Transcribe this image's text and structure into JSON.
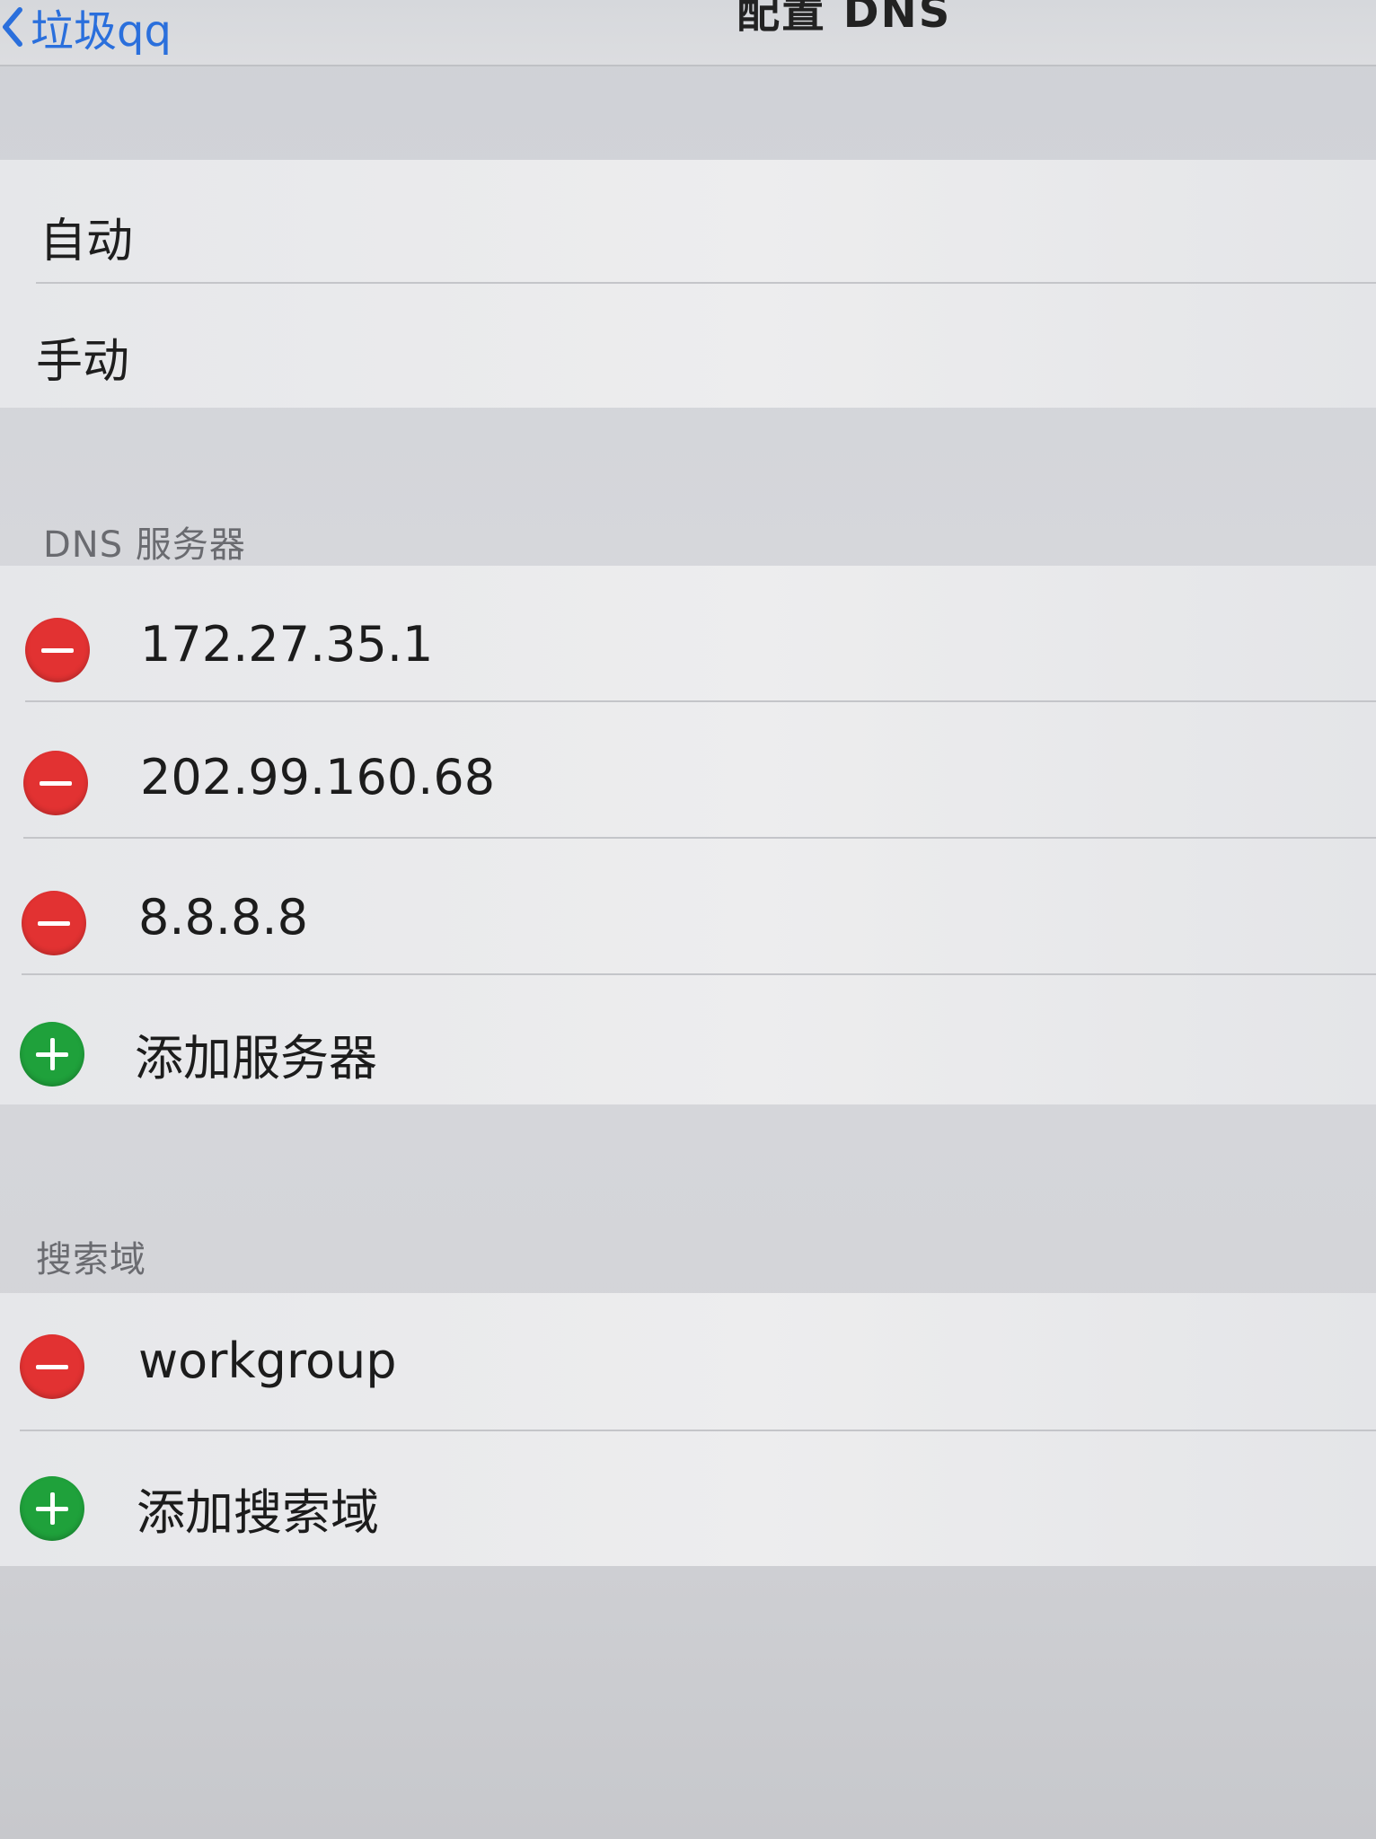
{
  "navbar": {
    "back_label": "垃圾qq",
    "title": "配置 DNS"
  },
  "config_mode": {
    "options": [
      {
        "label": "自动"
      },
      {
        "label": "手动"
      }
    ]
  },
  "dns_section": {
    "header": "DNS 服务器",
    "servers": [
      {
        "value": "172.27.35.1"
      },
      {
        "value": "202.99.160.68"
      },
      {
        "value": "8.8.8.8"
      }
    ],
    "add_label": "添加服务器"
  },
  "search_section": {
    "header": "搜索域",
    "domains": [
      {
        "value": "workgroup"
      }
    ],
    "add_label": "添加搜索域"
  },
  "colors": {
    "link": "#2a6fdc",
    "delete": "#e23232",
    "add": "#1fa13b"
  },
  "icons": {
    "back": "chevron-left-icon",
    "delete": "minus-circle-icon",
    "add": "plus-circle-icon"
  }
}
